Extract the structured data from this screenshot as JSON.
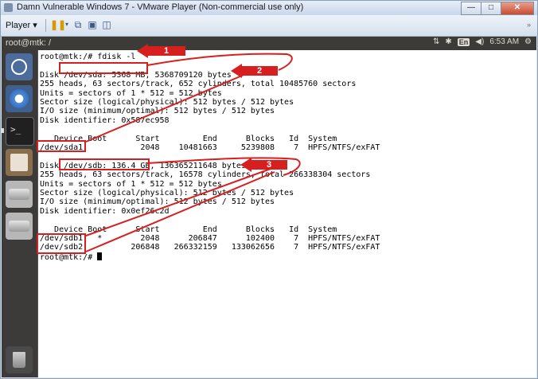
{
  "window": {
    "title": "Damn Vulnerable Windows 7 - VMware Player (Non-commercial use only)",
    "buttons": {
      "minimize": "—",
      "maximize": "□",
      "close": "✕"
    }
  },
  "vm_toolbar": {
    "player_label": "Player ▾"
  },
  "ubuntu_panel": {
    "window_title": "root@mtk: /",
    "keyboard": "En",
    "time": "6:53 AM"
  },
  "terminal": {
    "lines": [
      "root@mtk:/# fdisk -l",
      "",
      "Disk /dev/sda: 5368 MB, 5368709120 bytes",
      "255 heads, 63 sectors/track, 652 cylinders, total 10485760 sectors",
      "Units = sectors of 1 * 512 = 512 bytes",
      "Sector size (logical/physical): 512 bytes / 512 bytes",
      "I/O size (minimum/optimal): 512 bytes / 512 bytes",
      "Disk identifier: 0x587ec958",
      "",
      "   Device Boot      Start         End      Blocks   Id  System",
      "/dev/sda1            2048    10481663     5239808    7  HPFS/NTFS/exFAT",
      "",
      "Disk /dev/sdb: 136.4 GB, 136365211648 bytes",
      "255 heads, 63 sectors/track, 16578 cylinders, total 266338304 sectors",
      "Units = sectors of 1 * 512 = 512 bytes",
      "Sector size (logical/physical): 512 bytes / 512 bytes",
      "I/O size (minimum/optimal): 512 bytes / 512 bytes",
      "Disk identifier: 0x0ef26c2d",
      "",
      "   Device Boot      Start         End      Blocks   Id  System",
      "/dev/sdb1   *        2048      206847      102400    7  HPFS/NTFS/exFAT",
      "/dev/sdb2          206848   266332159   133062656    7  HPFS/NTFS/exFAT",
      "root@mtk:/# "
    ]
  },
  "annotations": {
    "step1": "1",
    "step2": "2",
    "step3": "3"
  },
  "colors": {
    "annotation_red": "#d81f1f",
    "panel_bg": "#3c3b37",
    "launcher_bg": "#3d3a3a"
  }
}
